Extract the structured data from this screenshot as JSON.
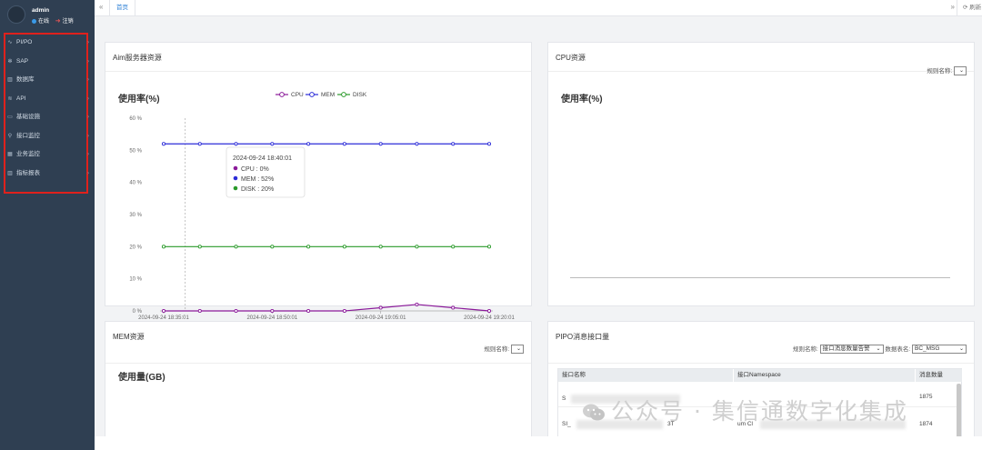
{
  "user": {
    "name": "admin",
    "status": "在线",
    "logout": "注销"
  },
  "sidebar": {
    "items": [
      {
        "label": "PI/PO",
        "icon": "pi-icon"
      },
      {
        "label": "SAP",
        "icon": "gear-icon"
      },
      {
        "label": "数据库",
        "icon": "bar-chart-icon"
      },
      {
        "label": "API",
        "icon": "wifi-icon"
      },
      {
        "label": "基础设施",
        "icon": "monitor-icon"
      },
      {
        "label": "接口监控",
        "icon": "link-icon"
      },
      {
        "label": "业务监控",
        "icon": "grid-icon"
      },
      {
        "label": "指标报表",
        "icon": "bar-chart-icon"
      }
    ]
  },
  "topbar": {
    "home_tab": "首页",
    "refresh": "刷新"
  },
  "panels": {
    "aim": {
      "title": "Aim服务器资源",
      "usage_title": "使用率(%)"
    },
    "cpu": {
      "title": "CPU资源",
      "rule_label": "规则名称:",
      "usage_title": "使用率(%)"
    },
    "mem": {
      "title": "MEM资源",
      "rule_label": "规则名称:",
      "usage_title": "使用量(GB)"
    },
    "pipo": {
      "title": "PIPO消息接口量",
      "rule_label": "规则名称:",
      "rule_value": "接口消息数量告警",
      "table_label": "数据表名:",
      "table_value": "BC_MSG",
      "columns": [
        "接口名称",
        "接口Namespace",
        "消息数量"
      ],
      "rows": [
        {
          "name": "S",
          "ns": "",
          "count": "1875"
        },
        {
          "name": "SI_",
          "ns": "um Cl",
          "count": "1874"
        }
      ],
      "row2_suffix": "3T"
    }
  },
  "tooltip": {
    "time": "2024-09-24 18:40:01",
    "lines": [
      "CPU : 0%",
      "MEM : 52%",
      "DISK : 20%"
    ]
  },
  "watermark": "公众号 · 集信通数字化集成",
  "colors": {
    "cpu": "#8b1a9a",
    "mem": "#2c2cd8",
    "disk": "#2a9a2a",
    "sidebar": "#2f3f52",
    "accent": "#2b7fd6"
  },
  "chart_data": {
    "type": "line",
    "title": "使用率(%)",
    "x": [
      "2024-09-24 18:35:01",
      "2024-09-24 18:40:01",
      "2024-09-24 18:45:01",
      "2024-09-24 18:50:01",
      "2024-09-24 18:55:01",
      "2024-09-24 19:00:01",
      "2024-09-24 19:05:01",
      "2024-09-24 19:10:01",
      "2024-09-24 19:15:01",
      "2024-09-24 19:20:01"
    ],
    "xticks": [
      "2024-09-24 18:35:01",
      "2024-09-24 18:50:01",
      "2024-09-24 19:05:01",
      "2024-09-24 19:20:01"
    ],
    "yticks": [
      "0 %",
      "10 %",
      "20 %",
      "30 %",
      "40 %",
      "50 %",
      "60 %"
    ],
    "ylim": [
      0,
      60
    ],
    "legend_position": "top-center",
    "series": [
      {
        "name": "CPU",
        "values": [
          0,
          0,
          0,
          0,
          0,
          0,
          1,
          2,
          1,
          0
        ]
      },
      {
        "name": "MEM",
        "values": [
          52,
          52,
          52,
          52,
          52,
          52,
          52,
          52,
          52,
          52
        ]
      },
      {
        "name": "DISK",
        "values": [
          20,
          20,
          20,
          20,
          20,
          20,
          20,
          20,
          20,
          20
        ]
      }
    ]
  }
}
